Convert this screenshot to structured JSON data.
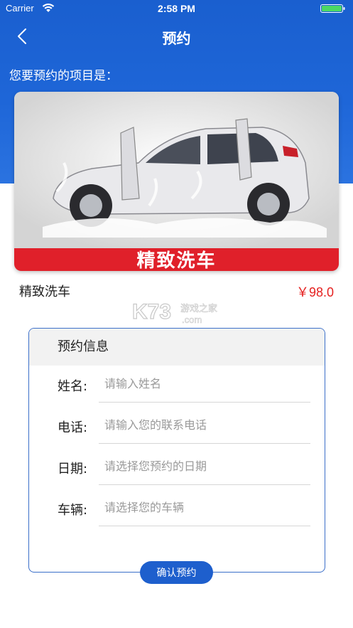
{
  "status_bar": {
    "carrier": "Carrier",
    "time": "2:58 PM"
  },
  "nav": {
    "title": "预约"
  },
  "intro": "您要预约的项目是：",
  "service": {
    "banner_text": "精致洗车",
    "name": "精致洗车",
    "price": "￥98.0"
  },
  "watermark": {
    "logo": "K73",
    "text": "游戏之家",
    "domain": ".com"
  },
  "form": {
    "header": "预约信息",
    "fields": [
      {
        "label": "姓名:",
        "placeholder": "请输入姓名"
      },
      {
        "label": "电话:",
        "placeholder": "请输入您的联系电话"
      },
      {
        "label": "日期:",
        "placeholder": "请选择您预约的日期"
      },
      {
        "label": "车辆:",
        "placeholder": "请选择您的车辆"
      }
    ]
  },
  "confirm_button": "确认预约",
  "colors": {
    "primary": "#1e5fcd",
    "price": "#e5201f",
    "banner": "#e0202a"
  }
}
